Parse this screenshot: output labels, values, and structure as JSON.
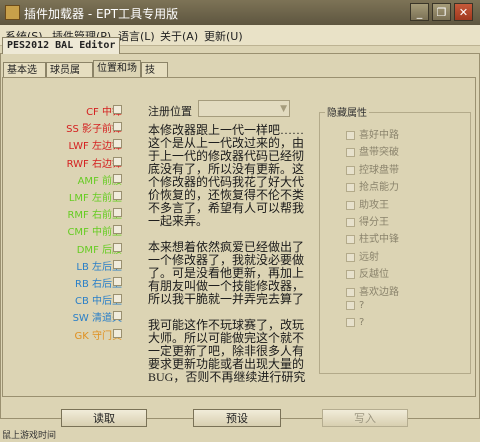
{
  "window": {
    "title": "插件加载器 - EPT工具专用版",
    "minimize": "_",
    "restore": "❐",
    "close": "✕"
  },
  "menu": [
    "系统(S)",
    "插件管理(P)",
    "语言(L)",
    "关于(A)",
    "更新(U)"
  ],
  "editor_tab": "PES2012 BAL Editor",
  "tabs": [
    "基本选择",
    "球员属性",
    "位置和场感",
    "技能"
  ],
  "active_tab": 2,
  "positions": [
    {
      "label": "CF 中锋",
      "color": "#d42020"
    },
    {
      "label": "SS 影子前锋",
      "color": "#d42020"
    },
    {
      "label": "LWF 左边锋",
      "color": "#d42020"
    },
    {
      "label": "RWF 右边锋",
      "color": "#d42020"
    },
    {
      "label": "AMF 前腰",
      "color": "#66cc22"
    },
    {
      "label": "LMF 左前卫",
      "color": "#66cc22"
    },
    {
      "label": "RMF 右前卫",
      "color": "#66cc22"
    },
    {
      "label": "CMF 中前卫",
      "color": "#66cc22"
    },
    {
      "label": "DMF 后腰",
      "color": "#66cc22"
    },
    {
      "label": "LB 左后卫",
      "color": "#2a7fc8"
    },
    {
      "label": "RB 右后卫",
      "color": "#2a7fc8"
    },
    {
      "label": "CB 中后卫",
      "color": "#2a7fc8"
    },
    {
      "label": "SW 清道夫",
      "color": "#2a7fc8"
    },
    {
      "label": "GK 守门员",
      "color": "#e09020"
    }
  ],
  "register": {
    "label": "注册位置",
    "value": ""
  },
  "note_paragraphs": [
    "本修改器跟上一代一样吧……这个是从上一代改过来的，由于上一代的修改器代码已经彻底没有了，所以没有更新。这个修改器的代码我花了好大代价恢复的，还恢复得不伦不类不多言了，希望有人可以帮我一起来弄。",
    "本来想着依然疯爱已经做出了一个修改器了，我就没必要做了。可是没看他更新，再加上有朋友叫做一个技能修改器，所以我干脆就一并弄完去算了",
    "我可能这作不玩球赛了，改玩大师。所以可能做完这个就不一定更新了吧，除非很多人有要求更新功能或者出现大量的BUG，否则不再继续进行研究"
  ],
  "hidden_attributes": {
    "title": "隐藏属性",
    "items": [
      "喜好中路",
      "盘带突破",
      "控球盘带",
      "抢点能力",
      "助攻王",
      "得分王",
      "柱式中锋",
      "远射",
      "反越位",
      "喜欢边路",
      "?",
      "?"
    ]
  },
  "buttons": {
    "read": "读取",
    "preset": "预设",
    "write": "写入"
  },
  "status": "鼠上游戏时间"
}
